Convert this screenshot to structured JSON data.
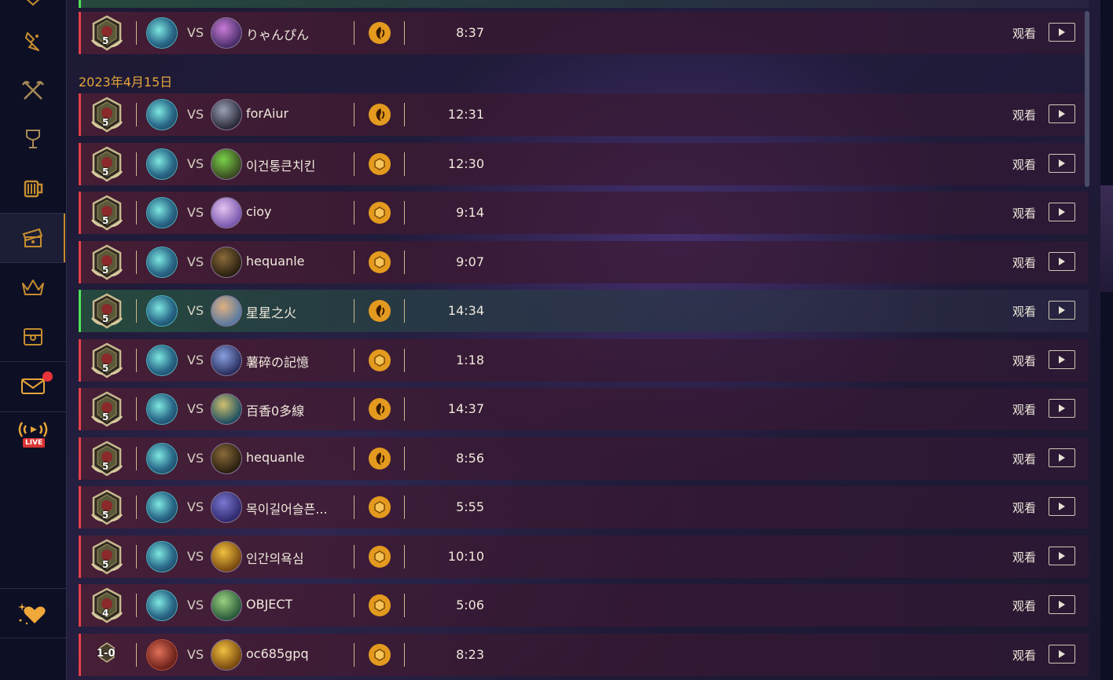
{
  "sidebar": {
    "items": [
      {
        "icon": "rank-badge-icon"
      },
      {
        "icon": "bird-icon"
      },
      {
        "icon": "crossed-axes-icon"
      },
      {
        "icon": "trophy-fist-icon"
      },
      {
        "icon": "tavern-mug-icon"
      },
      {
        "icon": "replay-ticket-icon",
        "active": true
      },
      {
        "icon": "crown-icon"
      },
      {
        "icon": "treasure-chest-icon"
      },
      {
        "icon": "mail-icon",
        "has_notification": true
      },
      {
        "icon": "live-broadcast-icon",
        "live_label": "LIVE"
      },
      {
        "icon": "sparkle-heart-icon"
      }
    ]
  },
  "date_header": "2023年4月15日",
  "vs_label": "VS",
  "watch_label": "观看",
  "colors": {
    "loss": "#e4404a",
    "win": "#4fe05a",
    "accent": "#e39a1f"
  },
  "top_row": {
    "rank": "5",
    "opponent": "りゃんぴん",
    "mode": "wild",
    "duration": "8:37",
    "result": "loss"
  },
  "matches": [
    {
      "rank": "5",
      "opponent": "forAiur",
      "mode": "wild",
      "duration": "12:31",
      "result": "loss"
    },
    {
      "rank": "5",
      "opponent": "이건통큰치킨",
      "mode": "standard",
      "duration": "12:30",
      "result": "loss"
    },
    {
      "rank": "5",
      "opponent": "cioy",
      "mode": "standard",
      "duration": "9:14",
      "result": "loss"
    },
    {
      "rank": "5",
      "opponent": "hequanle",
      "mode": "standard",
      "duration": "9:07",
      "result": "loss"
    },
    {
      "rank": "5",
      "opponent": "星星之火",
      "mode": "wild",
      "duration": "14:34",
      "result": "win"
    },
    {
      "rank": "5",
      "opponent": "薯碎の記憶",
      "mode": "standard",
      "duration": "1:18",
      "result": "loss"
    },
    {
      "rank": "5",
      "opponent": "百香0多線",
      "mode": "wild",
      "duration": "14:37",
      "result": "loss"
    },
    {
      "rank": "5",
      "opponent": "hequanle",
      "mode": "wild",
      "duration": "8:56",
      "result": "loss"
    },
    {
      "rank": "5",
      "opponent": "목이길어슬픈...",
      "mode": "standard",
      "duration": "5:55",
      "result": "loss"
    },
    {
      "rank": "5",
      "opponent": "인간의욕심",
      "mode": "standard",
      "duration": "10:10",
      "result": "loss"
    },
    {
      "rank": "4",
      "opponent": "OBJECT",
      "mode": "standard",
      "duration": "5:06",
      "result": "loss"
    },
    {
      "rank": "1-0",
      "opponent": "oc685gpq",
      "mode": "standard",
      "duration": "8:23",
      "result": "loss"
    }
  ]
}
